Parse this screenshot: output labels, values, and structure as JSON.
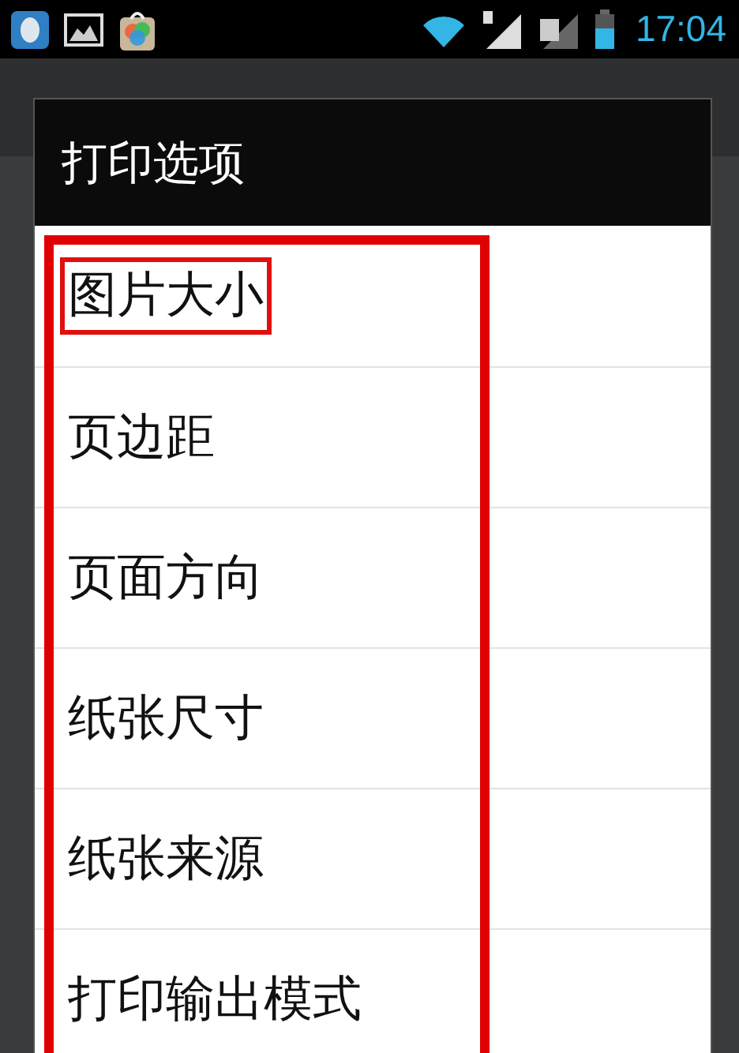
{
  "status_bar": {
    "time": "17:04"
  },
  "dialog": {
    "title": "打印选项",
    "items": [
      {
        "label": "图片大小",
        "highlighted": true
      },
      {
        "label": "页边距",
        "highlighted": false
      },
      {
        "label": "页面方向",
        "highlighted": false
      },
      {
        "label": "纸张尺寸",
        "highlighted": false
      },
      {
        "label": "纸张来源",
        "highlighted": false
      },
      {
        "label": "打印输出模式",
        "highlighted": false
      }
    ]
  }
}
